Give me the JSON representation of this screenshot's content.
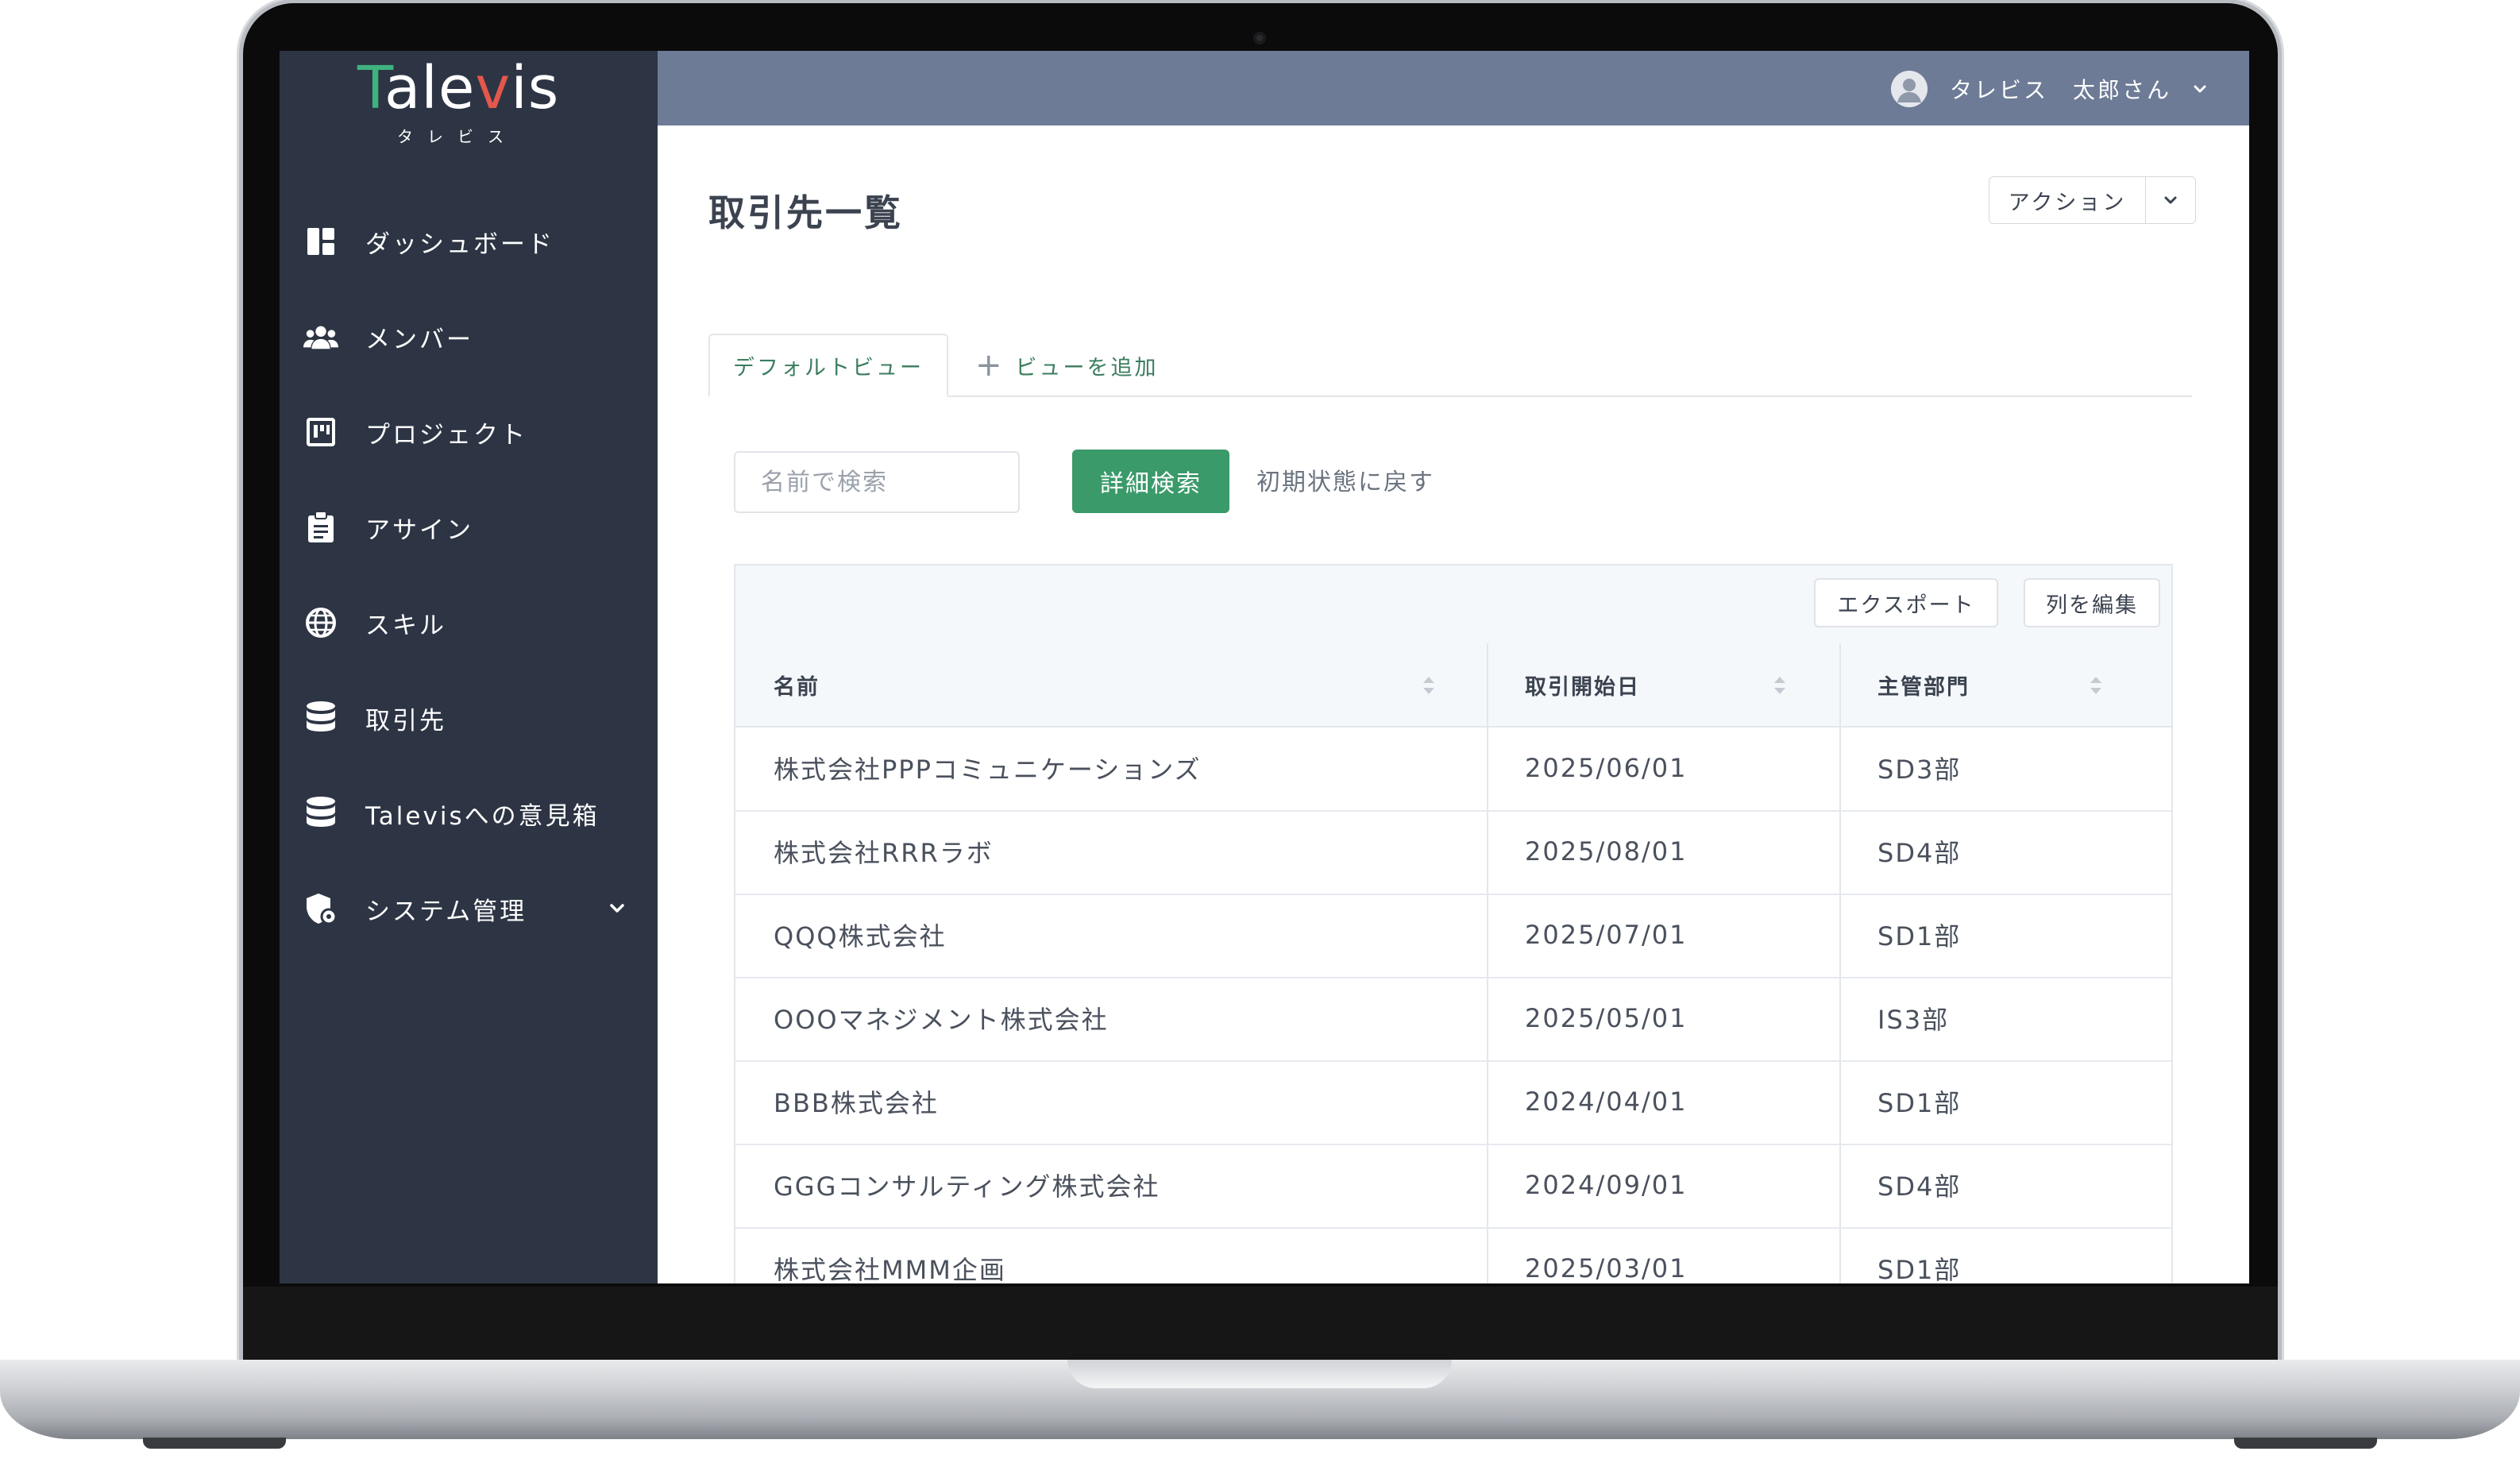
{
  "app": {
    "logo_word": "Talevis",
    "logo_kana": "タレビス"
  },
  "sidebar": {
    "items": [
      {
        "label": "ダッシュボード",
        "icon": "dashboard-icon"
      },
      {
        "label": "メンバー",
        "icon": "users-icon"
      },
      {
        "label": "プロジェクト",
        "icon": "kanban-icon"
      },
      {
        "label": "アサイン",
        "icon": "clipboard-icon"
      },
      {
        "label": "スキル",
        "icon": "globe-icon"
      },
      {
        "label": "取引先",
        "icon": "database-icon"
      },
      {
        "label": "Talevisへの意見箱",
        "icon": "database-icon"
      },
      {
        "label": "システム管理",
        "icon": "shield-gear-icon",
        "has_submenu": true
      }
    ]
  },
  "topbar": {
    "user_name": "タレビス　太郎さん",
    "avatar_icon": "user-avatar-icon"
  },
  "page": {
    "title": "取引先一覧",
    "action_label": "アクション"
  },
  "tabs": {
    "default_view": "デフォルトビュー",
    "add_view": "ビューを追加"
  },
  "search": {
    "placeholder": "名前で検索",
    "value": "",
    "detail_search": "詳細検索",
    "reset": "初期状態に戻す"
  },
  "table": {
    "export_label": "エクスポート",
    "edit_columns_label": "列を編集",
    "columns": [
      "名前",
      "取引開始日",
      "主管部門"
    ],
    "rows": [
      [
        "株式会社PPPコミュニケーションズ",
        "2025/06/01",
        "SD3部"
      ],
      [
        "株式会社RRRラボ",
        "2025/08/01",
        "SD4部"
      ],
      [
        "QQQ株式会社",
        "2025/07/01",
        "SD1部"
      ],
      [
        "OOOマネジメント株式会社",
        "2025/05/01",
        "IS3部"
      ],
      [
        "BBB株式会社",
        "2024/04/01",
        "SD1部"
      ],
      [
        "GGGコンサルティング株式会社",
        "2024/09/01",
        "SD4部"
      ],
      [
        "株式会社MMM企画",
        "2025/03/01",
        "SD1部"
      ]
    ]
  },
  "colors": {
    "sidebar_bg": "#2d3544",
    "topbar_bg": "#6d7b96",
    "accent_green": "#3a9a6a",
    "logo_t": "#3fb37f",
    "logo_v": "#e4574c"
  }
}
